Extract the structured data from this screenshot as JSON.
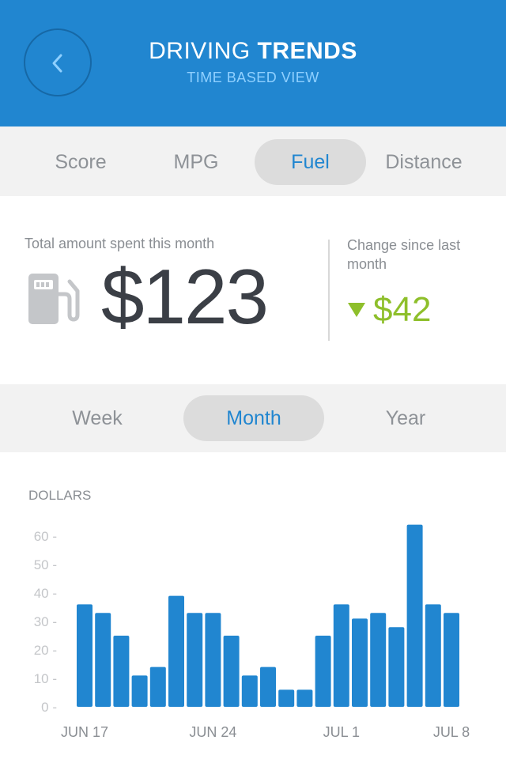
{
  "header": {
    "title_light": "DRIVING ",
    "title_bold": "TRENDS",
    "subtitle": "TIME BASED VIEW",
    "back_icon": "chevron-left-icon"
  },
  "metric_tabs": [
    {
      "label": "Score",
      "active": false
    },
    {
      "label": "MPG",
      "active": false
    },
    {
      "label": "Fuel",
      "active": true
    },
    {
      "label": "Distance",
      "active": false
    }
  ],
  "summary": {
    "total_label": "Total amount spent this month",
    "total_value": "$123",
    "icon": "fuel-pump-icon",
    "change_label": "Change since last month",
    "change_value": "$42",
    "change_direction": "down",
    "change_color": "#8ebf2b"
  },
  "period_tabs": [
    {
      "label": "Week",
      "active": false
    },
    {
      "label": "Month",
      "active": true
    },
    {
      "label": "Year",
      "active": false
    }
  ],
  "colors": {
    "accent": "#2186d0",
    "bar": "#2186d0",
    "tab_active_bg": "#dcdcdc",
    "text_dark": "#3b3f46",
    "text_muted": "#8e9297"
  },
  "chart_data": {
    "type": "bar",
    "ylabel": "DOLLARS",
    "ylim": [
      0,
      65
    ],
    "yticks": [
      0,
      10,
      20,
      30,
      40,
      50,
      60
    ],
    "tick_format": "{v} -",
    "values": [
      36,
      33,
      25,
      11,
      14,
      39,
      33,
      33,
      25,
      11,
      14,
      6,
      6,
      25,
      36,
      31,
      33,
      28,
      64,
      36,
      33
    ],
    "x_labels": [
      {
        "label": "JUN 17",
        "index": 0
      },
      {
        "label": "JUN 24",
        "index": 7
      },
      {
        "label": "JUL 1",
        "index": 14
      },
      {
        "label": "JUL 8",
        "index": 20
      }
    ],
    "grid": false
  }
}
